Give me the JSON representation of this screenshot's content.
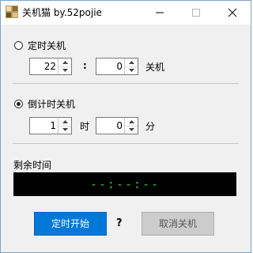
{
  "window": {
    "title": "关机猫 by.52pojie"
  },
  "scheduled": {
    "option_label": "定时关机",
    "selected": false,
    "hour_value": "22",
    "separator": ":",
    "minute_value": "0",
    "suffix": "关机"
  },
  "countdown": {
    "option_label": "倒计时关机",
    "selected": true,
    "hours_value": "1",
    "hours_unit": "时",
    "minutes_value": "0",
    "minutes_unit": "分"
  },
  "remaining": {
    "label": "剩余时间",
    "display": "--:--:--",
    "display_color": "#3ec83e"
  },
  "actions": {
    "start_label": "定时开始",
    "help_label": "?",
    "cancel_label": "取消关机",
    "accent": "#0078d7"
  }
}
